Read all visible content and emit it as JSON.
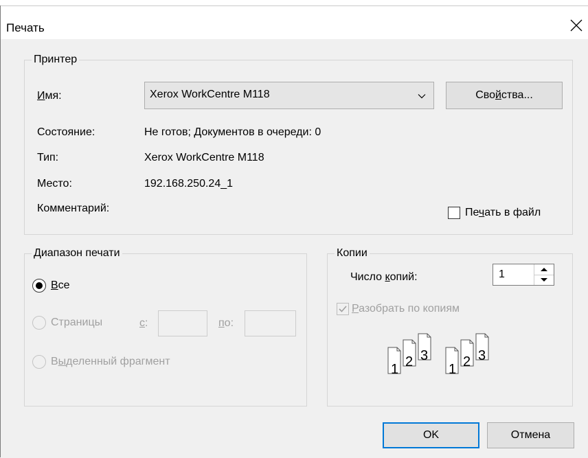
{
  "dialog": {
    "title": "Печать",
    "close_icon": "close-icon"
  },
  "printer": {
    "group_label": "Принтер",
    "name_label": "Имя:",
    "name_value": "Xerox WorkCentre M118",
    "properties_button": "Свойства...",
    "status_label": "Состояние:",
    "status_value": "Не готов; Документов в очереди: 0",
    "type_label": "Тип:",
    "type_value": "Xerox WorkCentre M118",
    "location_label": "Место:",
    "location_value": "192.168.250.24_1",
    "comment_label": "Комментарий:",
    "print_to_file_label": "Печать в файл",
    "print_to_file_checked": false
  },
  "range": {
    "group_label": "Диапазон печати",
    "all_label": "Все",
    "pages_label": "Страницы",
    "from_label": "с:",
    "to_label": "по:",
    "selection_label": "Выделенный фрагмент",
    "selected": "all"
  },
  "copies": {
    "group_label": "Копии",
    "count_label": "Число копий:",
    "count_value": "1",
    "collate_label": "Разобрать по копиям",
    "collate_checked": true,
    "collate_enabled": false,
    "page_numbers": [
      "1",
      "2",
      "3"
    ]
  },
  "footer": {
    "ok_label": "OK",
    "cancel_label": "Отмена"
  },
  "colors": {
    "accent": "#0078d7",
    "disabled_text": "#a0a0a0"
  }
}
